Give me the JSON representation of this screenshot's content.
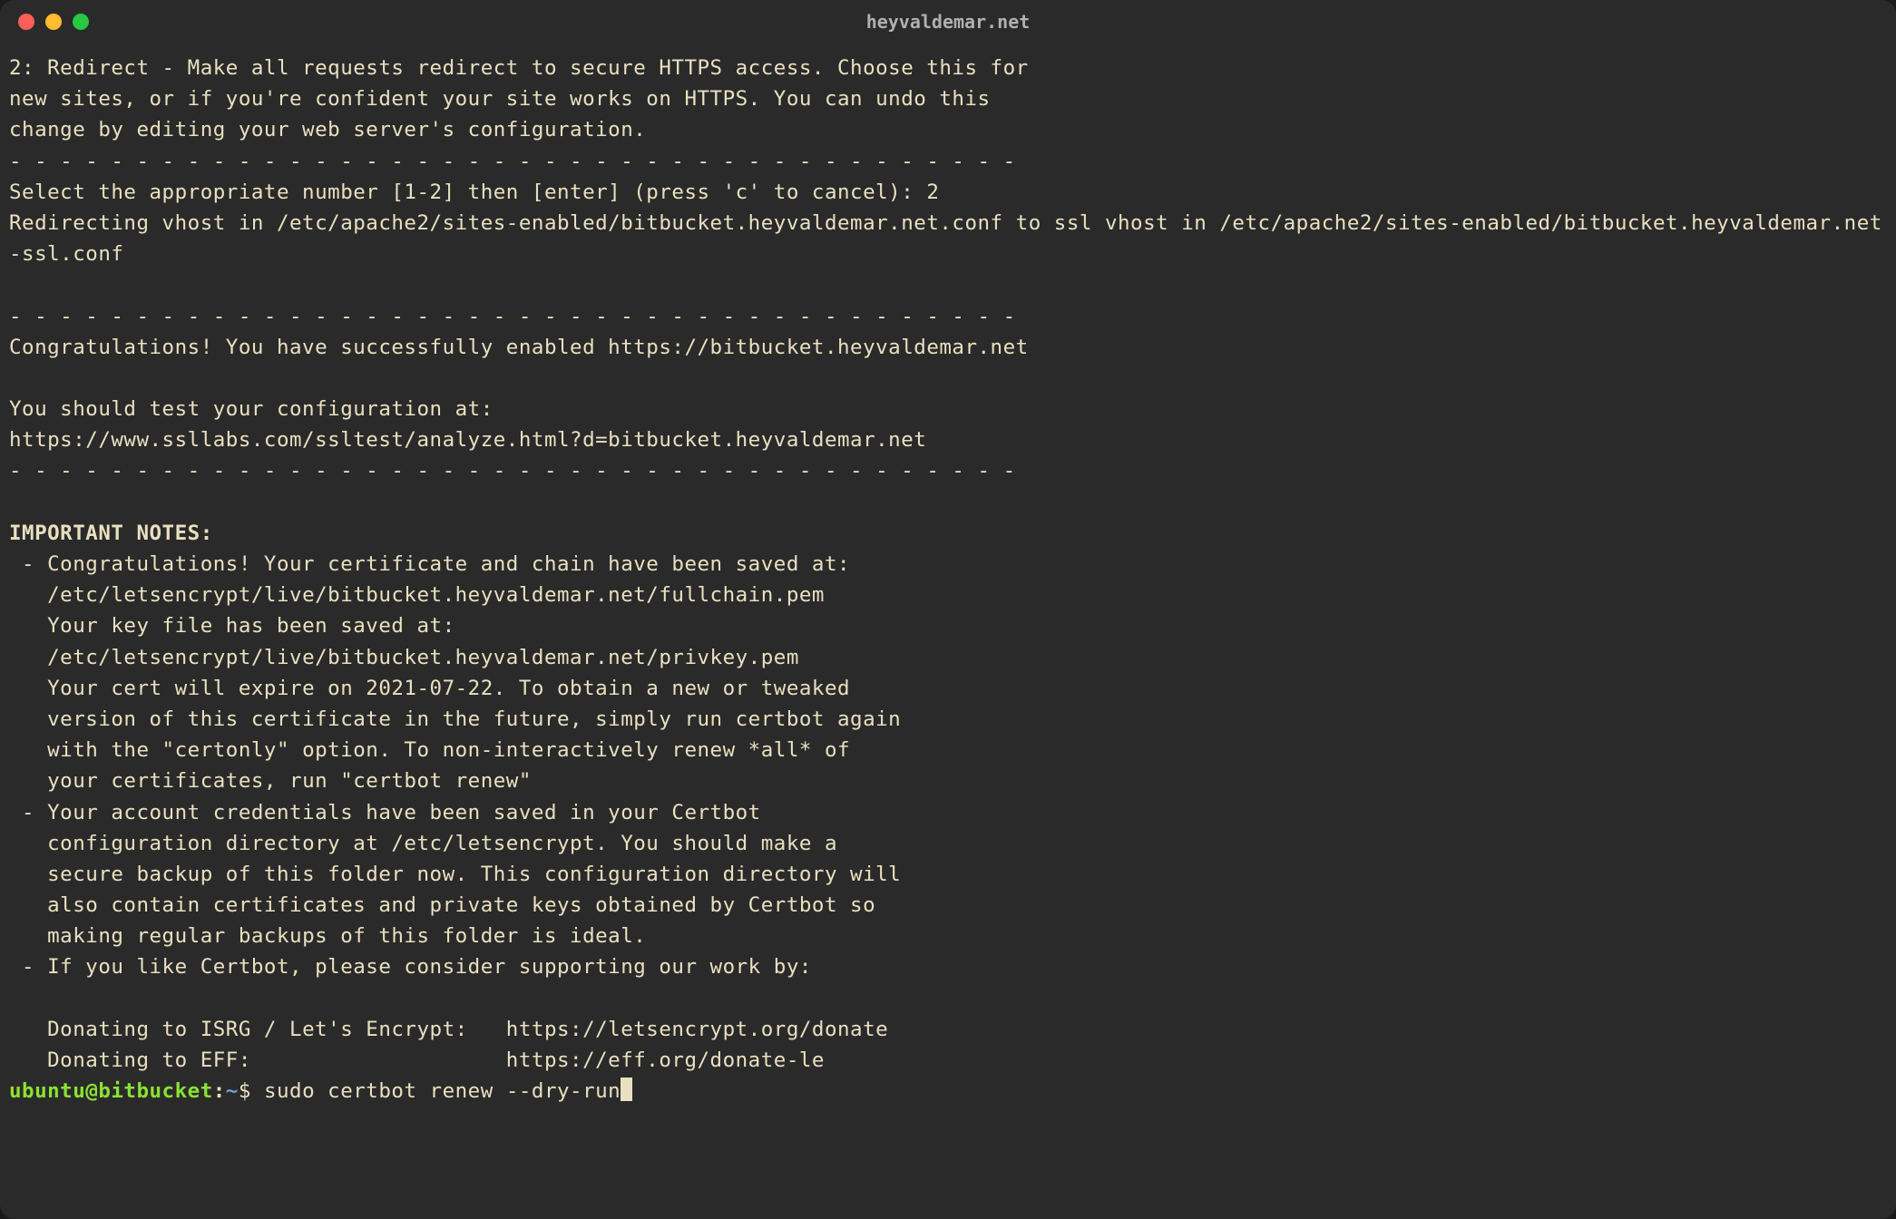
{
  "window": {
    "title": "heyvaldemar.net"
  },
  "terminal": {
    "block1_line1": "2: Redirect - Make all requests redirect to secure HTTPS access. Choose this for",
    "block1_line2": "new sites, or if you're confident your site works on HTTPS. You can undo this",
    "block1_line3": "change by editing your web server's configuration.",
    "separator1": "- - - - - - - - - - - - - - - - - - - - - - - - - - - - - - - - - - - - - - - -",
    "block2_line1": "Select the appropriate number [1-2] then [enter] (press 'c' to cancel): 2",
    "block2_line2": "Redirecting vhost in /etc/apache2/sites-enabled/bitbucket.heyvaldemar.net.conf to ssl vhost in /etc/apache2/sites-enabled/bitbucket.heyvaldemar.net-ssl.conf",
    "separator2": "- - - - - - - - - - - - - - - - - - - - - - - - - - - - - - - - - - - - - - - -",
    "congrats": "Congratulations! You have successfully enabled https://bitbucket.heyvaldemar.net",
    "test_line1": "You should test your configuration at:",
    "test_line2": "https://www.ssllabs.com/ssltest/analyze.html?d=bitbucket.heyvaldemar.net",
    "separator3": "- - - - - - - - - - - - - - - - - - - - - - - - - - - - - - - - - - - - - - - -",
    "notes_heading": "IMPORTANT NOTES:",
    "note1_l1": " - Congratulations! Your certificate and chain have been saved at:",
    "note1_l2": "   /etc/letsencrypt/live/bitbucket.heyvaldemar.net/fullchain.pem",
    "note1_l3": "   Your key file has been saved at:",
    "note1_l4": "   /etc/letsencrypt/live/bitbucket.heyvaldemar.net/privkey.pem",
    "note1_l5": "   Your cert will expire on 2021-07-22. To obtain a new or tweaked",
    "note1_l6": "   version of this certificate in the future, simply run certbot again",
    "note1_l7": "   with the \"certonly\" option. To non-interactively renew *all* of",
    "note1_l8": "   your certificates, run \"certbot renew\"",
    "note2_l1": " - Your account credentials have been saved in your Certbot",
    "note2_l2": "   configuration directory at /etc/letsencrypt. You should make a",
    "note2_l3": "   secure backup of this folder now. This configuration directory will",
    "note2_l4": "   also contain certificates and private keys obtained by Certbot so",
    "note2_l5": "   making regular backups of this folder is ideal.",
    "note3_l1": " - If you like Certbot, please consider supporting our work by:",
    "donate_l1": "   Donating to ISRG / Let's Encrypt:   https://letsencrypt.org/donate",
    "donate_l2": "   Donating to EFF:                    https://eff.org/donate-le",
    "prompt_user": "ubuntu@bitbucket",
    "prompt_colon": ":",
    "prompt_path": "~",
    "prompt_dollar": "$ ",
    "command": "sudo certbot renew --dry-run"
  }
}
